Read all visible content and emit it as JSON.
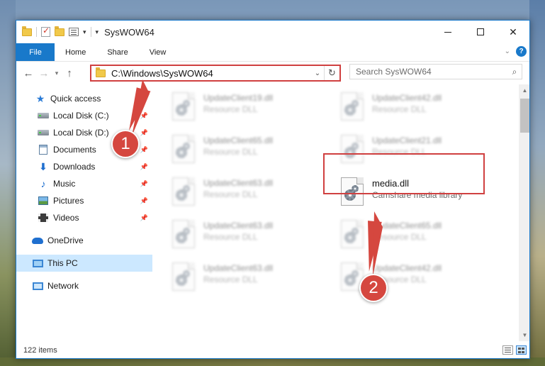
{
  "window": {
    "title": "SysWOW64"
  },
  "ribbon": {
    "tabs": [
      {
        "label": "File"
      },
      {
        "label": "Home"
      },
      {
        "label": "Share"
      },
      {
        "label": "View"
      }
    ],
    "help_label": "?"
  },
  "address_bar": {
    "path": "C:\\Windows\\SysWOW64",
    "refresh_glyph": "↻"
  },
  "search": {
    "placeholder": "Search SysWOW64"
  },
  "nav_pane": {
    "items": [
      {
        "label": "Quick access",
        "icon": "star-icon"
      },
      {
        "label": "Local Disk (C:)",
        "icon": "drive-icon"
      },
      {
        "label": "Local Disk (D:)",
        "icon": "drive-icon"
      },
      {
        "label": "Documents",
        "icon": "documents-icon"
      },
      {
        "label": "Downloads",
        "icon": "download-icon"
      },
      {
        "label": "Music",
        "icon": "music-icon"
      },
      {
        "label": "Pictures",
        "icon": "pictures-icon"
      },
      {
        "label": "Videos",
        "icon": "videos-icon"
      },
      {
        "label": "OneDrive",
        "icon": "cloud-icon"
      },
      {
        "label": "This PC",
        "icon": "computer-icon",
        "selected": true
      },
      {
        "label": "Network",
        "icon": "network-icon"
      }
    ]
  },
  "files": [
    {
      "name": "UpdateClient19.dll",
      "desc": "Resource DLL"
    },
    {
      "name": "UpdateClient42.dll",
      "desc": "Resource DLL"
    },
    {
      "name": "UpdateClient65.dll",
      "desc": "Resource DLL"
    },
    {
      "name": "UpdateClient21.dll",
      "desc": "Resource DLL"
    },
    {
      "name": "UpdateClient63.dll",
      "desc": "Resource DLL"
    },
    {
      "name": "media.dll",
      "desc": "Camshare media library"
    },
    {
      "name": "UpdateClient63.dll",
      "desc": "Resource DLL"
    },
    {
      "name": "UpdateClient65.dll",
      "desc": "Resource DLL"
    },
    {
      "name": "UpdateClient63.dll",
      "desc": "Resource DLL"
    },
    {
      "name": "UpdateClient42.dll",
      "desc": "Resource DLL"
    }
  ],
  "status": {
    "item_count": "122 items"
  },
  "annotations": {
    "step1": "1",
    "step2": "2",
    "color": "#d5473f"
  }
}
